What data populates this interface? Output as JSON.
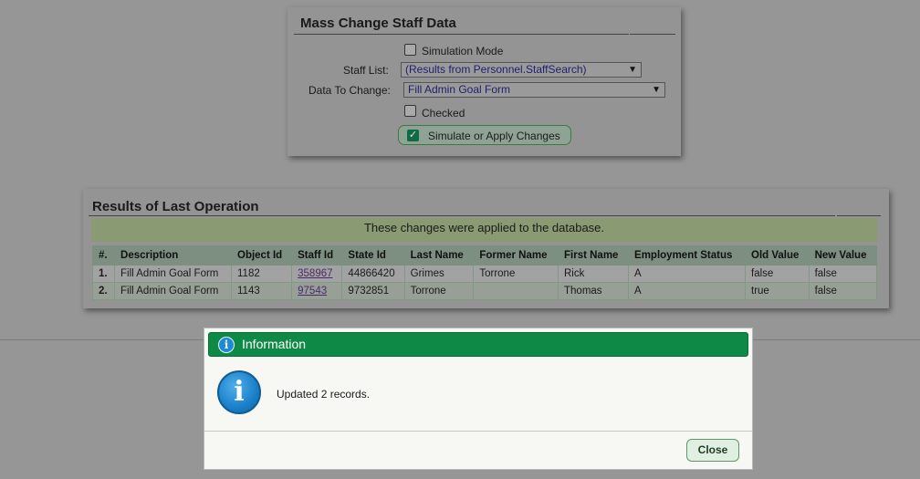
{
  "mass_change": {
    "title": "Mass Change Staff Data",
    "simulation_mode_label": "Simulation Mode",
    "simulation_mode_checked": false,
    "staff_list_label": "Staff List:",
    "staff_list_value": "(Results from Personnel.StaffSearch)",
    "data_to_change_label": "Data To Change:",
    "data_to_change_value": "Fill Admin Goal Form",
    "checked_label": "Checked",
    "checked_value": false,
    "apply_button_label": "Simulate or Apply Changes"
  },
  "results": {
    "title": "Results of Last Operation",
    "banner": "These changes were applied to the database.",
    "columns": [
      "#.",
      "Description",
      "Object Id",
      "Staff Id",
      "State Id",
      "Last Name",
      "Former Name",
      "First Name",
      "Employment Status",
      "Old Value",
      "New Value"
    ],
    "rows": [
      {
        "num": "1.",
        "description": "Fill Admin Goal Form",
        "object_id": "1182",
        "staff_id": "358967",
        "state_id": "44866420",
        "last_name": "Grimes",
        "former_name": "Torrone",
        "first_name": "Rick",
        "employment_status": "A",
        "old_value": "false",
        "new_value": "false"
      },
      {
        "num": "2.",
        "description": "Fill Admin Goal Form",
        "object_id": "1143",
        "staff_id": "97543",
        "state_id": "9732851",
        "last_name": "Torrone",
        "former_name": "",
        "first_name": "Thomas",
        "employment_status": "A",
        "old_value": "true",
        "new_value": "false"
      }
    ]
  },
  "dialog": {
    "title": "Information",
    "message": "Updated 2 records.",
    "close_label": "Close",
    "header_icon": "info-icon",
    "body_icon": "info-icon"
  },
  "colors": {
    "dialog_header": "#0f8a46",
    "info_icon": "#1b7fc9",
    "overlay": "#969696"
  }
}
